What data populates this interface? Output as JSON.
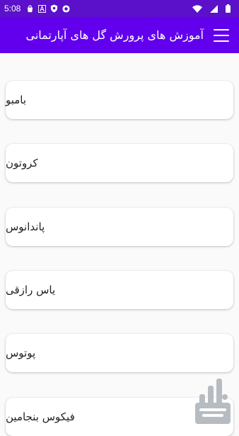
{
  "status_bar": {
    "time": "5:08",
    "icons": [
      "bag-icon",
      "a-icon",
      "shield-icon",
      "record-icon",
      "wifi-icon",
      "signal-icon",
      "battery-icon"
    ]
  },
  "toolbar": {
    "title": "آموزش های پرورش گل های آپارتمانی",
    "menu_icon": "hamburger-menu-icon"
  },
  "items": [
    {
      "label": "بامبو"
    },
    {
      "label": "کروتون"
    },
    {
      "label": "پاندانوس"
    },
    {
      "label": "یاس رازقی"
    },
    {
      "label": "پوتوس"
    },
    {
      "label": "فیکوس بنجامین"
    }
  ],
  "colors": {
    "status_bar": "#5b10c9",
    "toolbar": "#6200ee",
    "background": "#fafafa",
    "card": "#ffffff"
  }
}
